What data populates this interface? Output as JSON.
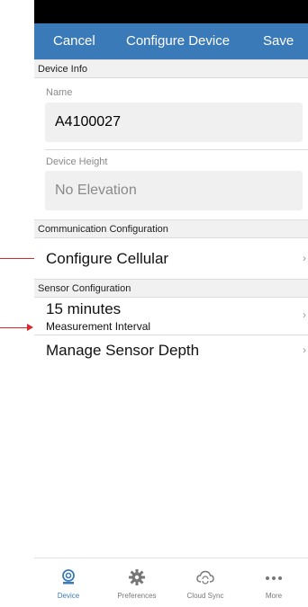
{
  "navbar": {
    "cancel_label": "Cancel",
    "title": "Configure Device",
    "save_label": "Save"
  },
  "device_info": {
    "header": "Device Info",
    "name_label": "Name",
    "name_value": "A4100027",
    "height_label": "Device Height",
    "height_value": "No Elevation"
  },
  "communication": {
    "header": "Communication Configuration",
    "configure_cellular": "Configure Cellular"
  },
  "sensor": {
    "header": "Sensor Configuration",
    "interval_value": "15 minutes",
    "interval_label": "Measurement Interval",
    "manage_depth": "Manage Sensor Depth"
  },
  "tabs": [
    {
      "label": "Device",
      "icon": "device-icon",
      "active": true
    },
    {
      "label": "Preferences",
      "icon": "gear-icon",
      "active": false
    },
    {
      "label": "Cloud Sync",
      "icon": "cloud-sync-icon",
      "active": false
    },
    {
      "label": "More",
      "icon": "more-dots-icon",
      "active": false
    }
  ],
  "colors": {
    "accent": "#3a7ab8",
    "annotation": "#d9272e"
  }
}
